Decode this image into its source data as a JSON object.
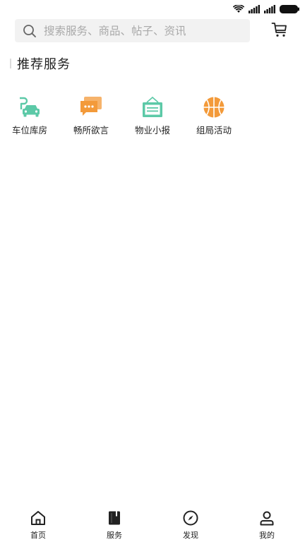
{
  "search": {
    "placeholder": "搜索服务、商品、帖子、资讯"
  },
  "section": {
    "title": "推荐服务"
  },
  "services": [
    {
      "label": "车位库房",
      "icon": "parking-car-icon"
    },
    {
      "label": "畅所欲言",
      "icon": "chat-bubbles-icon"
    },
    {
      "label": "物业小报",
      "icon": "notice-board-icon"
    },
    {
      "label": "组局活动",
      "icon": "basketball-icon"
    }
  ],
  "tabs": [
    {
      "label": "首页",
      "icon": "home-icon"
    },
    {
      "label": "服务",
      "icon": "service-card-icon"
    },
    {
      "label": "发现",
      "icon": "compass-icon"
    },
    {
      "label": "我的",
      "icon": "user-icon"
    }
  ],
  "colors": {
    "parking": "#5cc9a7",
    "chat": "#f39a3a",
    "notice": "#5cc9a7",
    "activity": "#f39a3a",
    "search_bg": "#f2f2f2",
    "text": "#222222"
  }
}
